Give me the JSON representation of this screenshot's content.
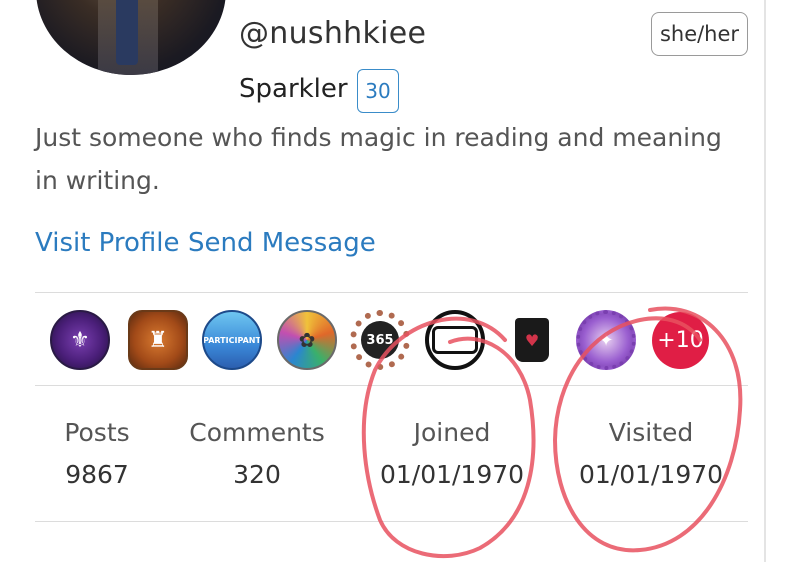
{
  "profile": {
    "handle": "@nushhkiee",
    "pronouns": "she/her",
    "rank_name": "Sparkler",
    "rank_number": "30",
    "bio": "Just someone who finds magic in reading and meaning in writing."
  },
  "actions": {
    "visit_profile": "Visit Profile",
    "send_message": "Send Message"
  },
  "badges": {
    "items": [
      {
        "icon": "purple-emblem-badge"
      },
      {
        "icon": "orange-crest-badge"
      },
      {
        "icon": "participant-rainbow-badge",
        "text": "PARTICIPANT"
      },
      {
        "icon": "colorful-wreath-badge"
      },
      {
        "icon": "365-badge",
        "text": "365"
      },
      {
        "icon": "circle-ring-badge"
      },
      {
        "icon": "dark-bag-badge"
      },
      {
        "icon": "purple-gear-badge"
      }
    ],
    "more_label": "+10"
  },
  "stats": [
    {
      "label": "Posts",
      "value": "9867"
    },
    {
      "label": "Comments",
      "value": "320"
    },
    {
      "label": "Joined",
      "value": "01/01/1970"
    },
    {
      "label": "Visited",
      "value": "01/01/1970"
    }
  ],
  "colors": {
    "link": "#2b7bbf",
    "annotation": "#e8515f",
    "more_badge": "#e01e45"
  }
}
